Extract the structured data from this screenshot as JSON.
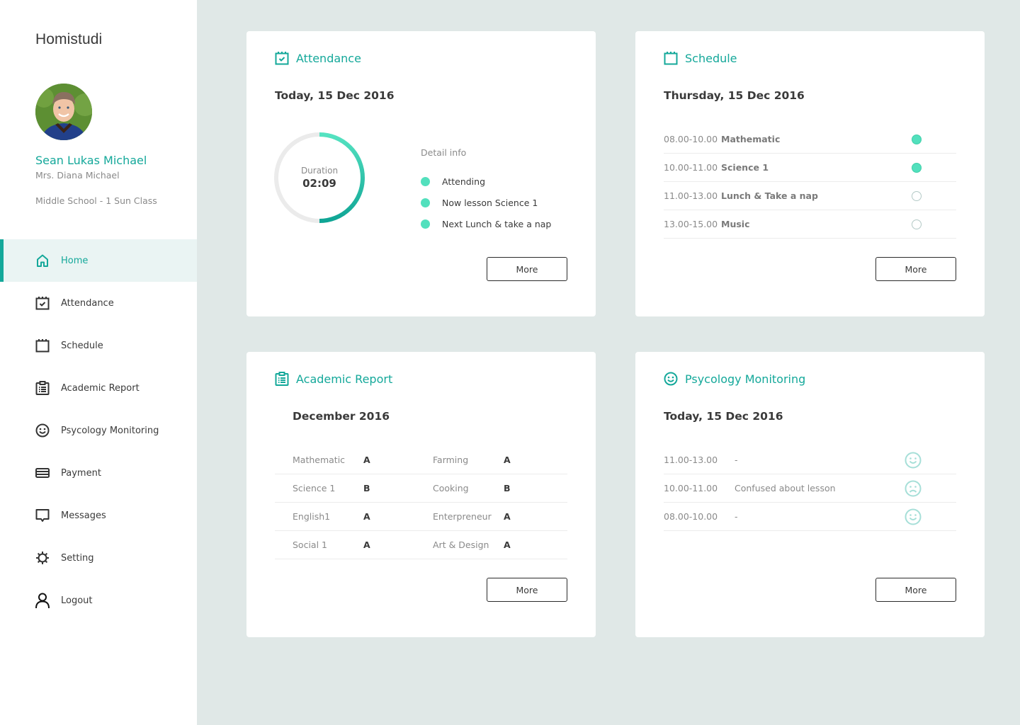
{
  "app": {
    "brand": "Homistudi"
  },
  "profile": {
    "student_name": "Sean Lukas Michael",
    "parent_name": "Mrs. Diana Michael",
    "class_name": "Middle School - 1 Sun Class"
  },
  "colors": {
    "accent": "#14a89a",
    "accent_light": "#52e0bd",
    "background": "#e0e8e7",
    "active_nav_bg": "#eaf4f3"
  },
  "sidebar": {
    "items": [
      {
        "label": "Home",
        "icon": "home-icon",
        "active": true
      },
      {
        "label": "Attendance",
        "icon": "calendar-check-icon",
        "active": false
      },
      {
        "label": "Schedule",
        "icon": "calendar-icon",
        "active": false
      },
      {
        "label": "Academic Report",
        "icon": "clipboard-list-icon",
        "active": false
      },
      {
        "label": "Psycology Monitoring",
        "icon": "smiley-icon",
        "active": false
      },
      {
        "label": "Payment",
        "icon": "credit-card-icon",
        "active": false
      },
      {
        "label": "Messages",
        "icon": "message-icon",
        "active": false
      },
      {
        "label": "Setting",
        "icon": "gear-icon",
        "active": false
      },
      {
        "label": "Logout",
        "icon": "user-icon",
        "active": false
      }
    ]
  },
  "attendance": {
    "title": "Attendance",
    "date": "Today, 15 Dec 2016",
    "duration_label": "Duration",
    "duration_value": "02:09",
    "progress_fraction": 0.5,
    "detail_title": "Detail info",
    "details": [
      {
        "label": "Attending"
      },
      {
        "label": "Now lesson Science 1"
      },
      {
        "label": "Next Lunch & take a nap"
      }
    ],
    "more_label": "More"
  },
  "schedule": {
    "title": "Schedule",
    "date": "Thursday, 15 Dec 2016",
    "rows": [
      {
        "time": "08.00-10.00",
        "subject": "Mathematic",
        "done": true
      },
      {
        "time": "10.00-11.00",
        "subject": "Science 1",
        "done": true
      },
      {
        "time": "11.00-13.00",
        "subject": "Lunch & Take a nap",
        "done": false
      },
      {
        "time": "13.00-15.00",
        "subject": "Music",
        "done": false
      }
    ],
    "more_label": "More"
  },
  "academic": {
    "title": "Academic Report",
    "period": "December 2016",
    "rows": [
      {
        "left": {
          "subject": "Mathematic",
          "grade": "A"
        },
        "right": {
          "subject": "Farming",
          "grade": "A"
        }
      },
      {
        "left": {
          "subject": "Science 1",
          "grade": "B"
        },
        "right": {
          "subject": "Cooking",
          "grade": "B"
        }
      },
      {
        "left": {
          "subject": "English1",
          "grade": "A"
        },
        "right": {
          "subject": "Enterpreneur",
          "grade": "A"
        }
      },
      {
        "left": {
          "subject": "Social 1",
          "grade": "A"
        },
        "right": {
          "subject": "Art & Design",
          "grade": "A"
        }
      }
    ],
    "more_label": "More"
  },
  "psychology": {
    "title": "Psycology Monitoring",
    "date": "Today, 15 Dec 2016",
    "rows": [
      {
        "time": "11.00-13.00",
        "note": "-",
        "mood": "happy"
      },
      {
        "time": "10.00-11.00",
        "note": "Confused about lesson",
        "mood": "sad"
      },
      {
        "time": "08.00-10.00",
        "note": "-",
        "mood": "happy"
      }
    ],
    "more_label": "More"
  }
}
